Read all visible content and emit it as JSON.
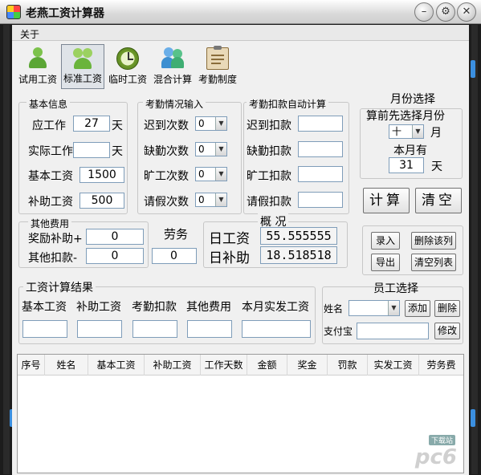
{
  "window": {
    "title": "老燕工资计算器",
    "controls": [
      "minimize-icon",
      "settings-icon",
      "close-icon"
    ]
  },
  "menu": {
    "about": "关于"
  },
  "toolbar": {
    "items": [
      {
        "label": "试用工资",
        "icon": "single-person-icon",
        "active": false
      },
      {
        "label": "标准工资",
        "icon": "group-people-icon",
        "active": true
      },
      {
        "label": "临时工资",
        "icon": "clock-icon",
        "active": false
      },
      {
        "label": "混合计算",
        "icon": "two-people-icon",
        "active": false
      },
      {
        "label": "考勤制度",
        "icon": "clipboard-icon",
        "active": false
      }
    ]
  },
  "basic_info": {
    "title": "基本信息",
    "should_work_label": "应工作",
    "should_work_value": "27",
    "day_unit": "天",
    "actual_work_label": "实际工作",
    "actual_work_value": "",
    "actual_unit": "天",
    "base_salary_label": "基本工资",
    "base_salary_value": "1500",
    "allowance_label": "补助工资",
    "allowance_value": "500"
  },
  "attendance_input": {
    "title": "考勤情况输入",
    "rows": [
      {
        "label": "迟到次数",
        "value": "0"
      },
      {
        "label": "缺勤次数",
        "value": "0"
      },
      {
        "label": "旷工次数",
        "value": "0"
      },
      {
        "label": "请假次数",
        "value": "0"
      }
    ]
  },
  "attendance_deduction": {
    "title": "考勤扣款自动计算",
    "rows": [
      {
        "label": "迟到扣款",
        "value": ""
      },
      {
        "label": "缺勤扣款",
        "value": ""
      },
      {
        "label": "旷工扣款",
        "value": ""
      },
      {
        "label": "请假扣款",
        "value": ""
      }
    ]
  },
  "month_select": {
    "title": "月份选择",
    "hint": "算前先选择月份",
    "month_value": "十",
    "month_unit": "月",
    "days_label": "本月有",
    "days_value": "31",
    "days_unit": "天"
  },
  "actions": {
    "calculate": "计算",
    "clear": "清空"
  },
  "other_fees": {
    "title": "其他费用",
    "bonus_label": "奖励补助+",
    "bonus_value": "0",
    "deduct_label": "其他扣款-",
    "deduct_value": "0"
  },
  "labor": {
    "label": "劳务",
    "value": "0"
  },
  "overview": {
    "title": "概 况",
    "daily_wage_label": "日工资",
    "daily_wage_value": "55.555555",
    "daily_allowance_label": "日补助",
    "daily_allowance_value": "18.518518"
  },
  "list_actions": {
    "record": "录入",
    "delete_row": "删除该列",
    "export": "导出",
    "clear_list": "清空列表"
  },
  "result": {
    "title": "工资计算结果",
    "fields": [
      "基本工资",
      "补助工资",
      "考勤扣款",
      "其他费用",
      "本月实发工资"
    ]
  },
  "employee": {
    "title": "员工选择",
    "name_label": "姓名",
    "name_value": "",
    "add": "添加",
    "delete": "删除",
    "alipay_label": "支付宝",
    "alipay_value": "",
    "modify": "修改"
  },
  "table": {
    "columns": [
      "序号",
      "姓名",
      "基本工资",
      "补助工资",
      "工作天数",
      "金额",
      "奖金",
      "罚款",
      "实发工资",
      "劳务费"
    ],
    "rows": []
  },
  "watermark": {
    "text": "pc6",
    "badge": "下载站"
  },
  "colors": {
    "accent": "#3b8fe0",
    "frame": "#1c1c1c",
    "client": "#f0f0f0"
  }
}
